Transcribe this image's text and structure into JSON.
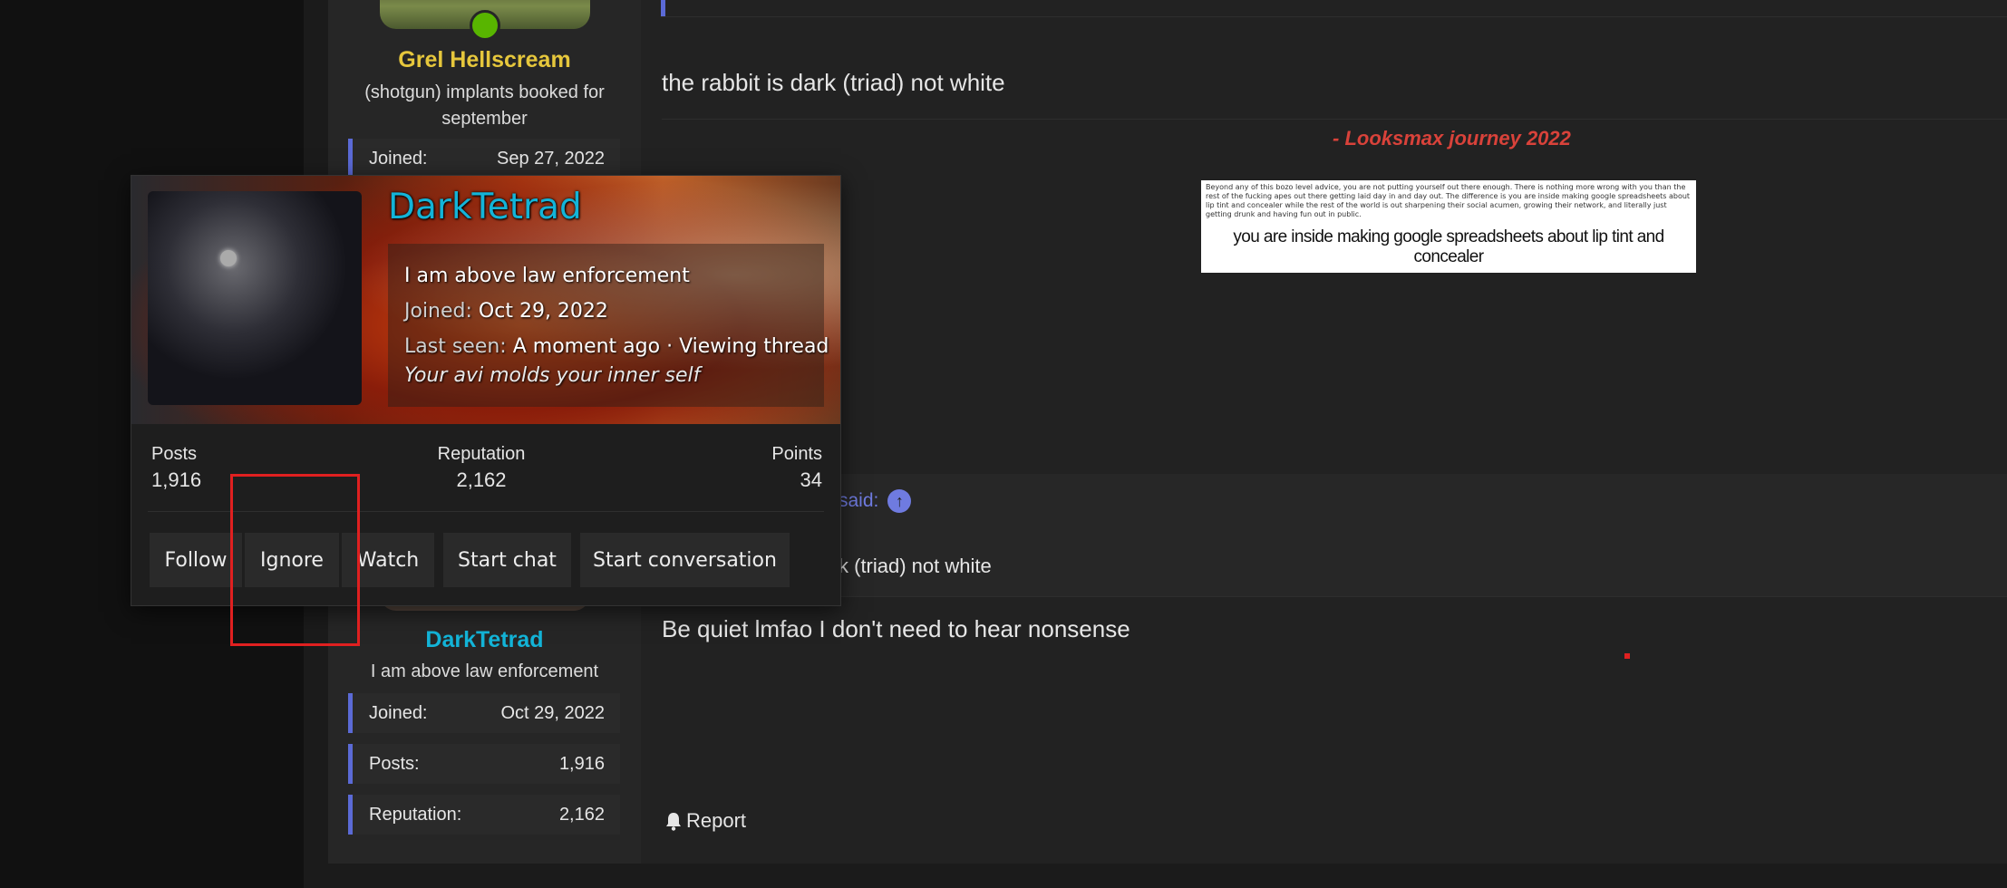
{
  "thread_users": {
    "user1": {
      "name": "Grel Hellscream",
      "title": "(shotgun) implants booked for september",
      "joined_label": "Joined:",
      "joined_value": "Sep 27, 2022"
    },
    "user2": {
      "name": "DarkTetrad",
      "title": "I am above law enforcement",
      "joined_label": "Joined:",
      "joined_value": "Oct 29, 2022",
      "posts_label": "Posts:",
      "posts_value": "1,916",
      "rep_label": "Reputation:",
      "rep_value": "2,162"
    }
  },
  "post1": {
    "message": "the rabbit is dark (triad) not white",
    "signature_title": "- Looksmax journey 2022",
    "signature_image_small_text": "Beyond any of this bozo level advice, you are not putting yourself out there enough. There is nothing more wrong with you than the rest of the fucking apes out there getting laid day in and day out. The difference is you are inside making google spreadsheets about lip tint and concealer while the rest of the world is out sharpening their social acumen, growing their network, and literally just getting drunk and having fun out in public.",
    "signature_image_big_text": "you are inside making google spreadsheets about lip tint and concealer"
  },
  "post2": {
    "quote_said": "said:",
    "quote_text_visible": "k (triad) not white",
    "message": "Be quiet lmfao I don't need to hear nonsense",
    "report_label": "Report"
  },
  "member_card": {
    "username": "DarkTetrad",
    "user_title": "I am above law enforcement",
    "joined_label": "Joined:",
    "joined_value": "Oct 29, 2022",
    "last_seen_label": "Last seen:",
    "last_seen_value": "A moment ago · Viewing thread",
    "signature": "Your avi molds your inner self",
    "stats": {
      "posts_label": "Posts",
      "posts_value": "1,916",
      "rep_label": "Reputation",
      "rep_value": "2,162",
      "points_label": "Points",
      "points_value": "34"
    },
    "buttons": {
      "follow": "Follow",
      "ignore": "Ignore",
      "watch": "Watch",
      "start_chat": "Start chat",
      "start_conversation": "Start conversation"
    }
  },
  "colors": {
    "accent_blue": "#5b6ad6",
    "username_cyan": "#13b4d8",
    "username_gold": "#e6c73c",
    "signature_red": "#d9423a",
    "highlight_red": "#e02020",
    "online_green": "#58b500"
  }
}
